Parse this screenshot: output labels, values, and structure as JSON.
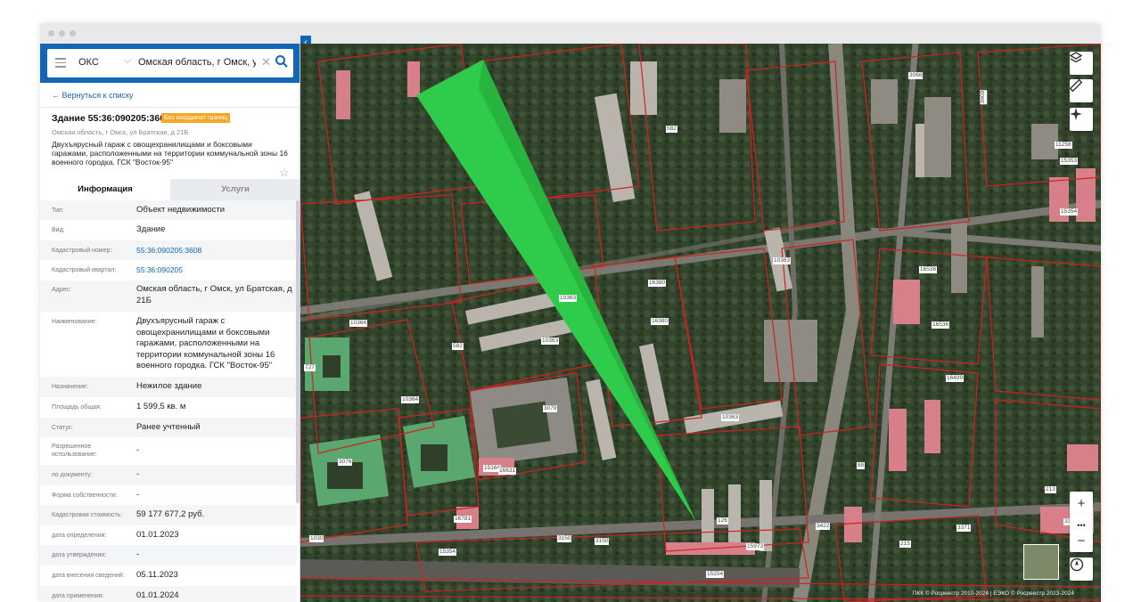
{
  "search": {
    "type": "ОКС",
    "query": "Омская область, г Омск, ул Бр"
  },
  "panel": {
    "back_link": "← Вернуться к списку",
    "title": "Здание 55:36:090205:3608",
    "badge": "Без координат границ",
    "address": "Омская область, г Омск, ул Братская, д 21Б",
    "description": "Двухъярусный гараж с овощехранилищами и боксовыми гаражами, расположенными на территории коммунальной зоны 16 военного городка. ГСК \"Восток-95\"",
    "tabs": [
      {
        "label": "Информация"
      },
      {
        "label": "Услуги"
      }
    ],
    "rows": [
      {
        "label": "Тип:",
        "value": "Объект недвижимости"
      },
      {
        "label": "Вид:",
        "value": "Здание"
      },
      {
        "label": "Кадастровый номер:",
        "value": "55:36:090205:3608"
      },
      {
        "label": "Кадастровый квартал:",
        "value": "55:36:090205"
      },
      {
        "label": "Адрес:",
        "value": "Омская область, г Омск, ул Братская, д 21Б"
      },
      {
        "label": "Наименование:",
        "value": "Двухъярусный гараж с овощехранилищами и боксовыми гаражами, расположенными на территории коммунальной зоны 16 военного городка. ГСК \"Восток-95\""
      },
      {
        "label": "Назначение:",
        "value": "Нежилое здание"
      },
      {
        "label": "Площадь общая:",
        "value": "1 599,5 кв. м"
      },
      {
        "label": "Статус:",
        "value": "Ранее учтенный"
      },
      {
        "label": "Разрешенное использование:",
        "value": "-"
      },
      {
        "label": "по документу:",
        "value": "-"
      },
      {
        "label": "Форма собственности:",
        "value": "-"
      },
      {
        "label": "Кадастровая стоимость:",
        "value": "59 177 677,2 руб."
      },
      {
        "label": "дата определения:",
        "value": "01.01.2023"
      },
      {
        "label": "дата утверждения:",
        "value": "-"
      },
      {
        "label": "дата внесения сведений:",
        "value": "05.11.2023"
      },
      {
        "label": "дата применения:",
        "value": "01.01.2024"
      }
    ]
  },
  "map": {
    "labels": [
      "3068",
      "3609",
      "582",
      "10364",
      "11256",
      "15353",
      "15354",
      "16536",
      "10363",
      "16380",
      "10363",
      "16380",
      "16536",
      "16499",
      "10363",
      "582",
      "10363",
      "3079",
      "10364",
      "3076",
      "15164",
      "16631",
      "126",
      "15973",
      "16781",
      "3150",
      "3150",
      "1030",
      "15354",
      "15254",
      "3422",
      "215",
      "3371",
      "213",
      "3359",
      "88",
      "727"
    ],
    "copyright": "ПКК © Росреестр 2010-2024 | ЕЭКО © Росреестр 2023-2024",
    "colors": {
      "parcel": "#d22020",
      "pointer": "#2ecc4a",
      "accent": "#1366b5",
      "badge": "#f5a623"
    }
  },
  "controls": {
    "zoom_in": "+",
    "zoom_out": "−",
    "more": "•••"
  }
}
